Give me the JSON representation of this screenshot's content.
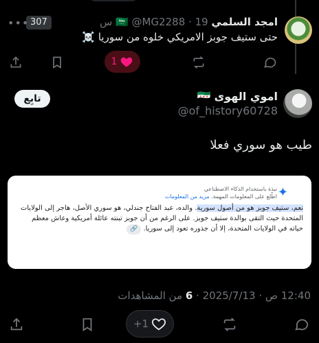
{
  "tweet1": {
    "name": "امجد السلمي",
    "flag": "🇸🇦",
    "handle": "@MG2288",
    "time": "19 س",
    "separator": "·",
    "count_badge": "307",
    "more": "•••",
    "text": "حتى ستيف جوبز الامريكي خلوه من سوريا ☠️",
    "likes": "1"
  },
  "tweet2": {
    "name": "اموي الهوى",
    "flag": "🇸🇾",
    "handle": "@of_history60728",
    "follow_label": "تابِع",
    "text": "طيب هو سوري فعلا",
    "meta_time": "12:40 ص · 2025/7/13 ·",
    "meta_views_count": "6",
    "meta_views_label": "من المشاهدات",
    "bottom_likes": "+1"
  },
  "ai_card": {
    "title": "نبذة باستخدام الذكاء الاصطناعي",
    "subtitle": "اطّلع على المعلومات المهمة.",
    "learn_more": "مزيد من المعلومات",
    "highlight": "نعم، ستيف جوبز هو من أصول سورية",
    "body": ". والده، عبد الفتاح جندلي، هو سوري الأصل، هاجر إلى الولايات المتحدة حيث التقى بوالدة ستيف جوبز. على الرغم من أن جوبز تبنته عائلة أمريكية وعاش معظم حياته في الولايات المتحدة، إلا أن جذوره تعود إلى سوريا."
  },
  "colors": {
    "background": "#000000",
    "text": "#e7e9ea",
    "muted": "#71767b",
    "like": "#f91880",
    "ai_link": "#1a73e8"
  }
}
